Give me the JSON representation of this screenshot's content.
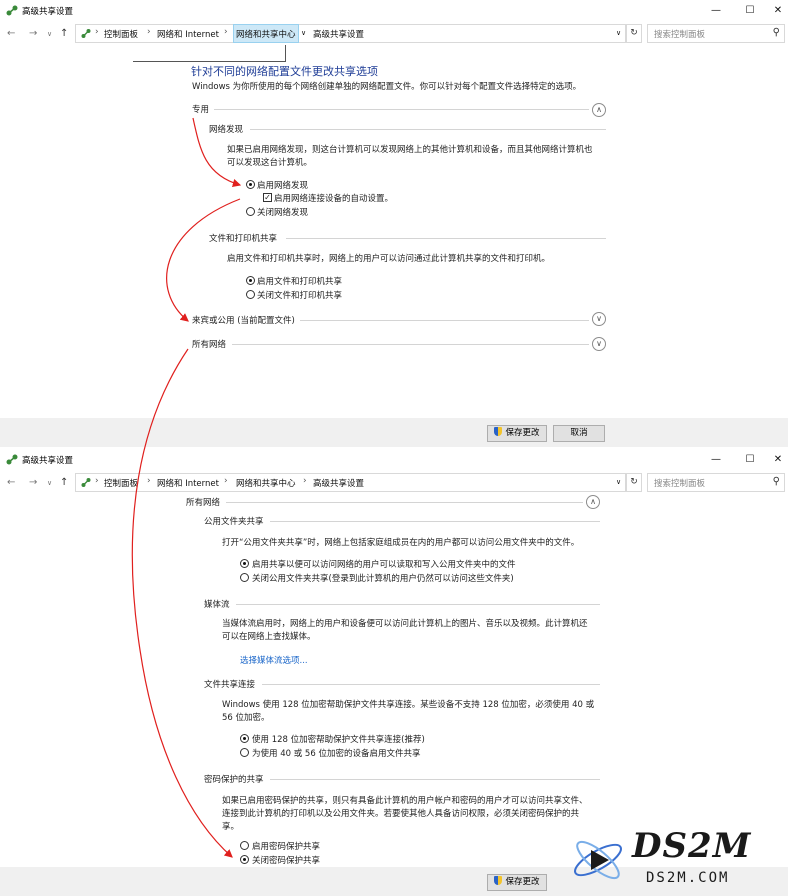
{
  "window_title": "高级共享设置",
  "breadcrumb": [
    "控制面板",
    "网络和 Internet",
    "网络和共享中心",
    "高级共享设置"
  ],
  "search_placeholder": "搜索控制面板",
  "top": {
    "heading": "针对不同的网络配置文件更改共享选项",
    "intro": "Windows 为你所使用的每个网络创建单独的网络配置文件。你可以针对每个配置文件选择特定的选项。",
    "private_label": "专用",
    "discovery": {
      "title": "网络发现",
      "desc1": "如果已启用网络发现，则这台计算机可以发现网络上的其他计算机和设备，而且其他网络计算机也",
      "desc2": "可以发现这台计算机。",
      "on": "启用网络发现",
      "auto": "启用网络连接设备的自动设置。",
      "off": "关闭网络发现"
    },
    "fileprint": {
      "title": "文件和打印机共享",
      "desc": "启用文件和打印机共享时，网络上的用户可以访问通过此计算机共享的文件和打印机。",
      "on": "启用文件和打印机共享",
      "off": "关闭文件和打印机共享"
    },
    "guest_label": "来宾或公用 (当前配置文件)",
    "all_label": "所有网络",
    "save": "保存更改",
    "cancel": "取消"
  },
  "bottom": {
    "all_label": "所有网络",
    "public_folder": {
      "title": "公用文件夹共享",
      "desc": "打开“公用文件夹共享”时，网络上包括家庭组成员在内的用户都可以访问公用文件夹中的文件。",
      "on": "启用共享以便可以访问网络的用户可以读取和写入公用文件夹中的文件",
      "off": "关闭公用文件夹共享(登录到此计算机的用户仍然可以访问这些文件夹)"
    },
    "media": {
      "title": "媒体流",
      "desc1": "当媒体流启用时，网络上的用户和设备便可以访问此计算机上的图片、音乐以及视频。此计算机还",
      "desc2": "可以在网络上查找媒体。",
      "link": "选择媒体流选项..."
    },
    "fileconn": {
      "title": "文件共享连接",
      "desc1": "Windows 使用 128 位加密帮助保护文件共享连接。某些设备不支持 128 位加密，必须使用 40 或",
      "desc2": "56 位加密。",
      "opt1": "使用 128 位加密帮助保护文件共享连接(推荐)",
      "opt2": "为使用 40 或 56 位加密的设备启用文件共享"
    },
    "password": {
      "title": "密码保护的共享",
      "desc1": "如果已启用密码保护的共享，则只有具备此计算机的用户帐户和密码的用户才可以访问共享文件、",
      "desc2": "连接到此计算机的打印机以及公用文件夹。若要使其他人具备访问权限，必须关闭密码保护的共",
      "desc3": "享。",
      "on": "启用密码保护共享",
      "off": "关闭密码保护共享"
    },
    "save": "保存更改"
  },
  "watermark": {
    "big": "DS2M",
    "small": "DS2M.COM"
  },
  "colors": {
    "heading": "#1e3c96",
    "link": "#1a66c9",
    "arrow": "#e0201e",
    "highlight": "#cde8f7"
  }
}
